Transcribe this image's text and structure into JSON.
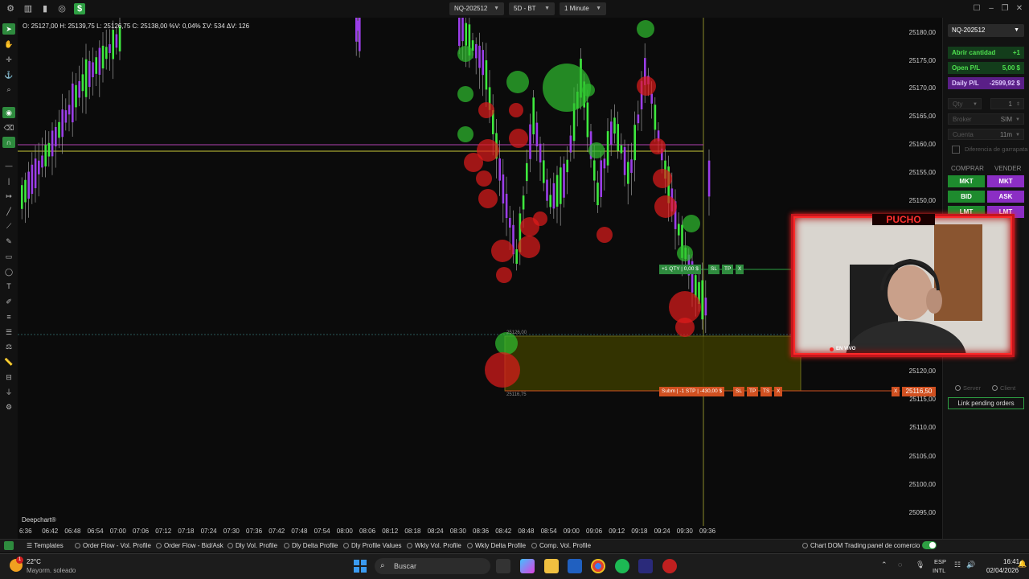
{
  "topbar": {
    "symbol": "NQ-202512",
    "timeframe_period": "5D - BT",
    "interval": "1 Minute",
    "icons": [
      "settings-icon",
      "chart-icon",
      "bar-chart-icon",
      "globe-icon",
      "dollar-icon"
    ]
  },
  "chart": {
    "ohlc_text": "O: 25127,00  H: 25139,75  L: 25126,75  C: 25138,00  %V: 0,04%  ΣV: 534  ΔV: 126",
    "watermark": "Deepchart®",
    "price_labels": [
      "25180,00",
      "25175,00",
      "25170,00",
      "25165,00",
      "25160,00",
      "25155,00",
      "25150,00",
      "25120,00",
      "25115,00",
      "25110,00",
      "25105,00",
      "25100,00",
      "25095,00"
    ],
    "time_labels": [
      "6:36",
      "06:42",
      "06:48",
      "06:54",
      "07:00",
      "07:06",
      "07:12",
      "07:18",
      "07:24",
      "07:30",
      "07:36",
      "07:42",
      "07:48",
      "07:54",
      "08:00",
      "08:06",
      "08:12",
      "08:18",
      "08:24",
      "08:30",
      "08:36",
      "08:42",
      "08:48",
      "08:54",
      "09:00",
      "09:06",
      "09:12",
      "09:18",
      "09:24",
      "09:30",
      "09:36"
    ],
    "zone_top_label": "25126,00",
    "zone_bottom_label": "25116,75",
    "order_long": "+1 QTY | 0,00 $",
    "order_stop": "Subm | -1 STP | -430,00 $",
    "stop_price_tag": "25116,50",
    "tag_sl": "SL",
    "tag_tp": "TP",
    "tag_ts": "TS",
    "tag_x": "X"
  },
  "bottombar": {
    "templates": "Templates",
    "items": [
      "Order Flow - Vol. Profile",
      "Order Flow - Bid/Ask",
      "Dly Vol. Profile",
      "Dly Delta Profile",
      "Dly Profile Values",
      "Wkly Vol. Profile",
      "Wkly Delta Profile",
      "Comp. Vol. Profile"
    ],
    "chart_dom": "Chart DOM Trading",
    "panel": "panel de comercio"
  },
  "rightpanel": {
    "symbol": "NQ-202512",
    "open_qty_label": "Abrir cantidad",
    "open_qty_value": "+1",
    "open_pl_label": "Open P/L",
    "open_pl_value": "5,00 $",
    "daily_pl_label": "Daily P/L",
    "daily_pl_value": "-2599,92 $",
    "qty_label": "Qty",
    "qty_value": "1",
    "broker_label": "Broker",
    "broker_value": "SIM",
    "account_label": "Cuenta",
    "account_value": "11m",
    "diff_label": "Diferencia de garrapata",
    "buy_header": "COMPRAR",
    "sell_header": "VENDER",
    "buy_buttons": [
      "MKT",
      "BID",
      "LMT"
    ],
    "sell_buttons": [
      "MKT",
      "ASK",
      "LMT"
    ],
    "server": "Server",
    "client": "Client",
    "link_orders": "Link pending orders"
  },
  "webcam": {
    "title": "PUCHO",
    "live": "EN VIVO"
  },
  "taskbar": {
    "weather_temp": "22°C",
    "weather_desc": "Mayorm. soleado",
    "search_placeholder": "Buscar",
    "lang1": "ESP",
    "lang2": "INTL",
    "time": "16:41",
    "date": "02/04/2026",
    "notification_count": "1"
  },
  "colors": {
    "up": "#3ee83e",
    "down": "#9b3ee8",
    "buy_bubble": "#2fbf2f",
    "sell_bubble": "#e01b1b",
    "zone": "#4a4a00"
  }
}
